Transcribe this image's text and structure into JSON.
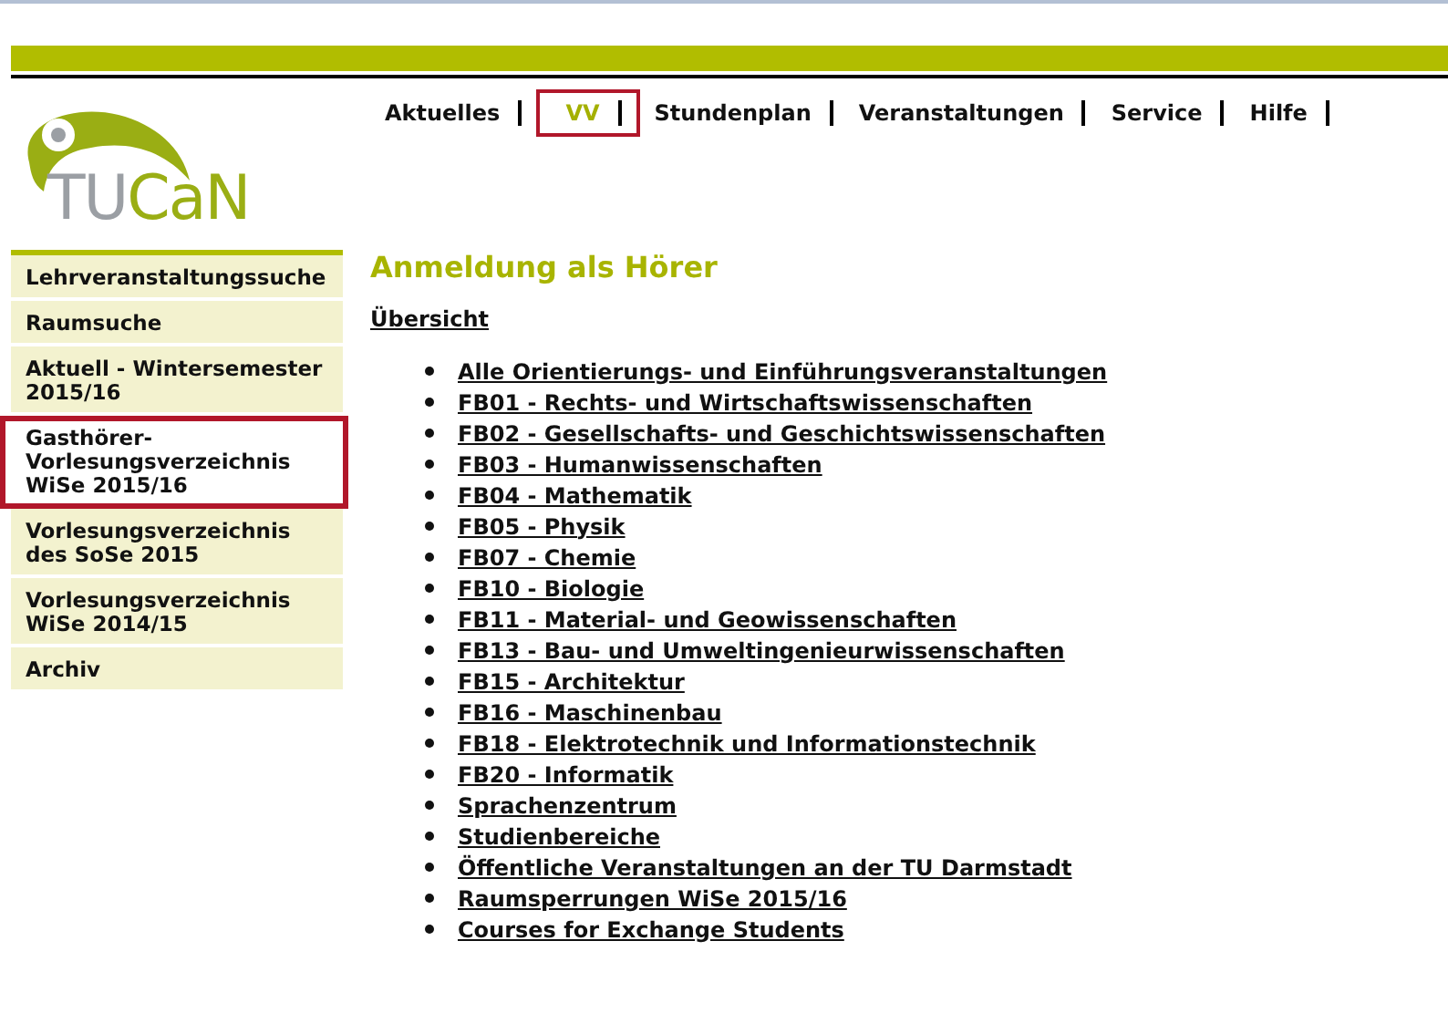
{
  "nav": [
    {
      "label": "Aktuelles",
      "selected": false,
      "highlighted": false
    },
    {
      "label": "VV",
      "selected": true,
      "highlighted": true
    },
    {
      "label": "Stundenplan",
      "selected": false,
      "highlighted": false
    },
    {
      "label": "Veranstaltungen",
      "selected": false,
      "highlighted": false
    },
    {
      "label": "Service",
      "selected": false,
      "highlighted": false
    },
    {
      "label": "Hilfe",
      "selected": false,
      "highlighted": false
    }
  ],
  "logo": {
    "parts": [
      {
        "text": "TU",
        "color": "#9b9fa4"
      },
      {
        "text": "CaN",
        "color": "#9aae14"
      }
    ]
  },
  "sidebar": {
    "items": [
      {
        "label": "Lehrveranstaltungssuche",
        "selected": false,
        "highlighted": false
      },
      {
        "label": "Raumsuche",
        "selected": false,
        "highlighted": false
      },
      {
        "label": "Aktuell - Wintersemester 2015/16",
        "selected": false,
        "highlighted": false
      },
      {
        "label": "Gasthörer-Vorlesungsverzeichnis WiSe 2015/16",
        "selected": true,
        "highlighted": true
      },
      {
        "label": "Vorlesungsverzeichnis des SoSe 2015",
        "selected": false,
        "highlighted": false
      },
      {
        "label": "Vorlesungsverzeichnis WiSe 2014/15",
        "selected": false,
        "highlighted": false
      },
      {
        "label": "Archiv",
        "selected": false,
        "highlighted": false
      }
    ]
  },
  "content": {
    "title": "Anmeldung als Hörer",
    "overview_link": "Übersicht",
    "links": [
      "Alle Orientierungs- und Einführungsveranstaltungen",
      "FB01 - Rechts- und Wirtschaftswissenschaften",
      "FB02 - Gesellschafts- und Geschichtswissenschaften",
      "FB03 - Humanwissenschaften",
      "FB04 - Mathematik",
      "FB05 - Physik",
      "FB07 - Chemie",
      "FB10 - Biologie",
      "FB11 - Material- und Geowissenschaften",
      "FB13 - Bau- und Umweltingenieurwissenschaften",
      "FB15 - Architektur",
      "FB16 - Maschinenbau",
      "FB18 - Elektrotechnik und Informationstechnik",
      "FB20 - Informatik",
      "Sprachenzentrum",
      "Studienbereiche",
      "Öffentliche Veranstaltungen an der TU Darmstadt",
      "Raumsperrungen WiSe 2015/16",
      "Courses for Exchange Students"
    ]
  }
}
